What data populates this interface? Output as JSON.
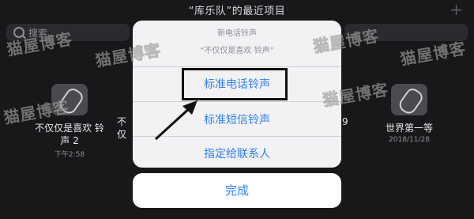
{
  "header": {
    "title": "“库乐队”的最近项目",
    "plus": "+"
  },
  "search": {
    "placeholder": "搜索"
  },
  "projects": [
    {
      "name_line1": "不仅仅是喜欢 铃",
      "name_line2": "声 2",
      "date": "下午2:58"
    },
    {
      "name": "不仅"
    },
    {
      "name": "9"
    },
    {
      "name": "世界第一等",
      "date": "2018/11/28"
    }
  ],
  "watermark": {
    "text": "猫屋博客"
  },
  "sheet": {
    "title": "新电话铃声",
    "subtitle": "“不仅仅是喜欢 铃声”",
    "options": [
      "标准电话铃声",
      "标准短信铃声",
      "指定给联系人"
    ]
  },
  "done_label": "完成"
}
